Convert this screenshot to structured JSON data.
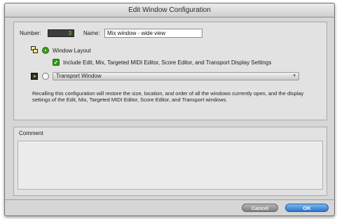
{
  "window": {
    "title": "Edit Window Configuration"
  },
  "config": {
    "number_label": "Number:",
    "number_value": "3",
    "name_label": "Name:",
    "name_value": "Mix window - wide view"
  },
  "options": {
    "window_layout_label": "Window Layout",
    "window_layout_selected": true,
    "include_label": "Include Edit, Mix, Targeted MIDI Editor, Score Editor, and Transport Display Settings",
    "include_checked": true,
    "transport_selected": false,
    "transport_dropdown_value": "Transport Window"
  },
  "description": "Recalling this configuration will restore the size, location, and order of all the windows currently open, and the display settings of the Edit, Mix, Targeted MIDI Editor, Score Editor, and Transport windows.",
  "comment": {
    "label": "Comment",
    "value": ""
  },
  "buttons": {
    "cancel": "Cancel",
    "ok": "OK"
  },
  "colors": {
    "accent_green": "#3c9a19",
    "ok_blue": "#2e73c8",
    "counter_green": "#7ddc3a"
  }
}
